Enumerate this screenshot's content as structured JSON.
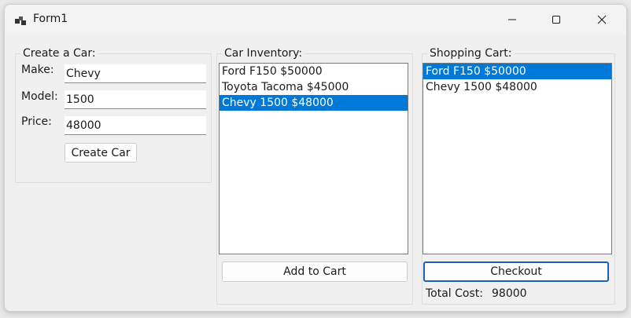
{
  "window": {
    "title": "Form1"
  },
  "create_car": {
    "legend": "Create a Car:",
    "make_label": "Make:",
    "make_value": "Chevy",
    "model_label": "Model:",
    "model_value": "1500",
    "price_label": "Price:",
    "price_value": "48000",
    "create_button": "Create Car"
  },
  "inventory": {
    "legend": "Car Inventory:",
    "items": [
      {
        "label": "Ford F150 $50000",
        "selected": false
      },
      {
        "label": "Toyota Tacoma $45000",
        "selected": false
      },
      {
        "label": "Chevy 1500 $48000",
        "selected": true
      }
    ],
    "add_button": "Add to Cart"
  },
  "cart": {
    "legend": "Shopping Cart:",
    "items": [
      {
        "label": "Ford F150 $50000",
        "selected": true
      },
      {
        "label": "Chevy 1500 $48000",
        "selected": false
      }
    ],
    "checkout_button": "Checkout",
    "total_label": "Total Cost:",
    "total_value": "98000"
  },
  "colors": {
    "selection": "#0078d7",
    "focus_border": "#1a5fb4"
  }
}
